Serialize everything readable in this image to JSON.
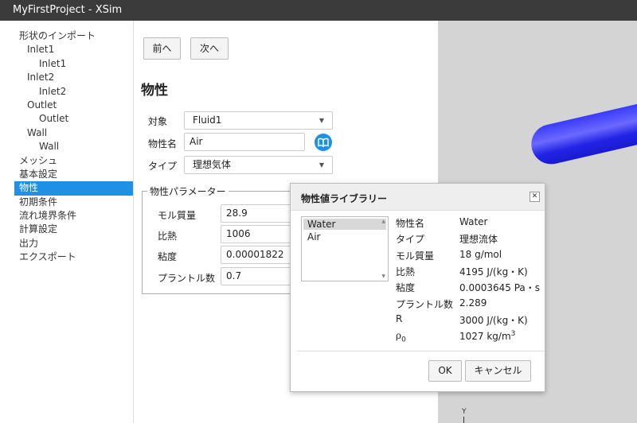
{
  "window": {
    "title": "MyFirstProject - XSim"
  },
  "sidebar": {
    "items": [
      {
        "label": "形状のインポート",
        "level": 0,
        "selected": false
      },
      {
        "label": "Inlet1",
        "level": 1,
        "selected": false
      },
      {
        "label": "Inlet1",
        "level": 2,
        "selected": false
      },
      {
        "label": "Inlet2",
        "level": 1,
        "selected": false
      },
      {
        "label": "Inlet2",
        "level": 2,
        "selected": false
      },
      {
        "label": "Outlet",
        "level": 1,
        "selected": false
      },
      {
        "label": "Outlet",
        "level": 2,
        "selected": false
      },
      {
        "label": "Wall",
        "level": 1,
        "selected": false
      },
      {
        "label": "Wall",
        "level": 2,
        "selected": false
      },
      {
        "label": "メッシュ",
        "level": 0,
        "selected": false
      },
      {
        "label": "基本設定",
        "level": 0,
        "selected": false
      },
      {
        "label": "物性",
        "level": 0,
        "selected": true
      },
      {
        "label": "初期条件",
        "level": 0,
        "selected": false
      },
      {
        "label": "流れ境界条件",
        "level": 0,
        "selected": false
      },
      {
        "label": "計算設定",
        "level": 0,
        "selected": false
      },
      {
        "label": "出力",
        "level": 0,
        "selected": false
      },
      {
        "label": "エクスポート",
        "level": 0,
        "selected": false
      }
    ]
  },
  "nav": {
    "prev_label": "前へ",
    "next_label": "次へ"
  },
  "panel": {
    "title": "物性",
    "target_label": "対象",
    "target_value": "Fluid1",
    "name_label": "物性名",
    "name_value": "Air",
    "type_label": "タイプ",
    "type_value": "理想気体"
  },
  "params": {
    "legend": "物性パラメーター",
    "molar_mass_label": "モル質量",
    "molar_mass_value": "28.9",
    "specific_heat_label": "比熱",
    "specific_heat_value": "1006",
    "viscosity_label": "粘度",
    "viscosity_value": "0.00001822",
    "prandtl_label": "プラントル数",
    "prandtl_value": "0.7"
  },
  "dialog": {
    "title": "物性値ライブラリー",
    "list": [
      "Water",
      "Air"
    ],
    "selected_index": 0,
    "props": [
      {
        "label": "物性名",
        "value": "Water"
      },
      {
        "label": "タイプ",
        "value": "理想流体"
      },
      {
        "label": "モル質量",
        "value": "18  g/mol"
      },
      {
        "label": "比熱",
        "value": "4195  J/(kg・K)"
      },
      {
        "label": "粘度",
        "value": "0.0003645  Pa・s"
      },
      {
        "label": "プラントル数",
        "value": "2.289"
      },
      {
        "label": "R",
        "value": "3000  J/(kg・K)"
      },
      {
        "label_base": "ρ",
        "label_sub": "0",
        "value_main": "1027  kg/m",
        "value_sup": "3"
      }
    ],
    "ok_label": "OK",
    "cancel_label": "キャンセル"
  },
  "viewport": {
    "axis_label": "Y"
  },
  "colors": {
    "accent": "#1e90e6",
    "titlebar": "#3b3b3b",
    "pipe": "#3030f0"
  }
}
